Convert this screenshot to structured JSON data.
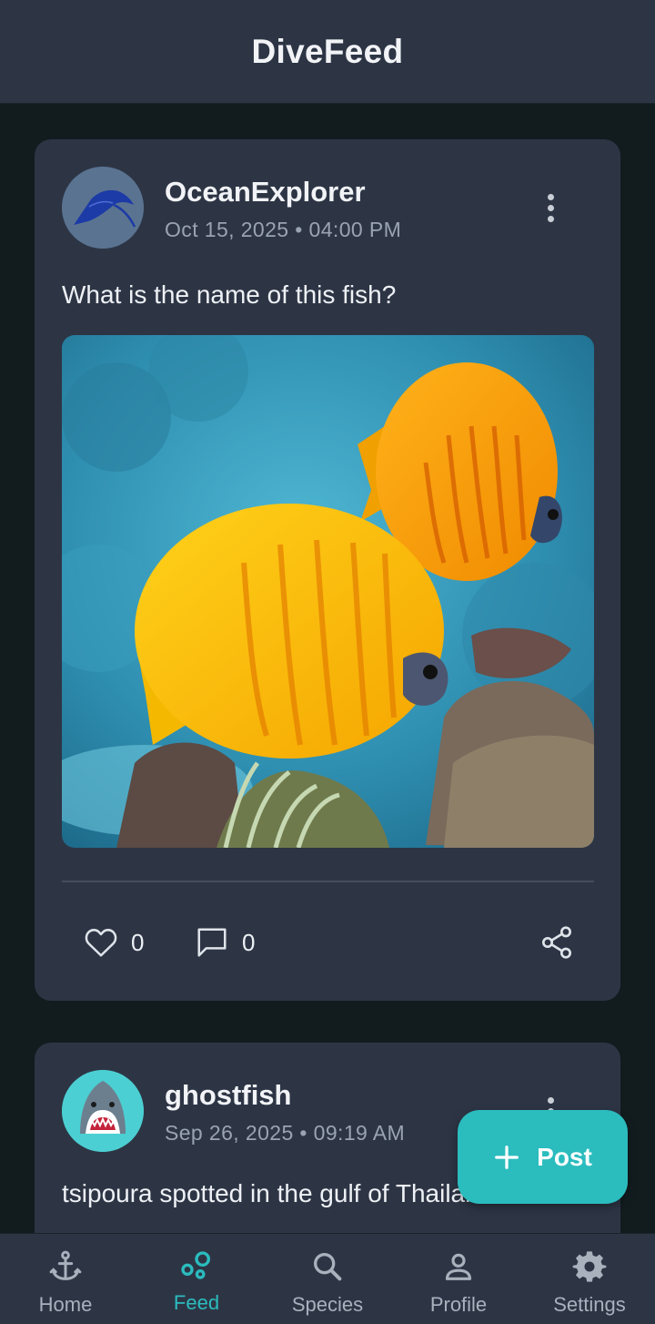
{
  "app": {
    "title": "DiveFeed"
  },
  "posts": [
    {
      "username": "OceanExplorer",
      "timestamp": "Oct 15, 2025 • 04:00 PM",
      "text": "What is the name of this fish?",
      "likes": "0",
      "comments": "0",
      "avatar_icon": "manta-ray-icon"
    },
    {
      "username": "ghostfish",
      "timestamp": "Sep 26, 2025 • 09:19 AM",
      "text": "tsipoura spotted in the gulf of Thailand !",
      "avatar_icon": "shark-icon"
    }
  ],
  "fab": {
    "label": "Post"
  },
  "nav": {
    "items": [
      {
        "label": "Home",
        "icon": "anchor-icon"
      },
      {
        "label": "Feed",
        "icon": "bubbles-icon",
        "active": true
      },
      {
        "label": "Species",
        "icon": "search-icon"
      },
      {
        "label": "Profile",
        "icon": "person-icon"
      },
      {
        "label": "Settings",
        "icon": "gear-icon"
      }
    ]
  },
  "colors": {
    "background": "#121c1f",
    "surface": "#2d3545",
    "accent": "#2bbcbe",
    "muted_text": "#9aa3b0"
  }
}
